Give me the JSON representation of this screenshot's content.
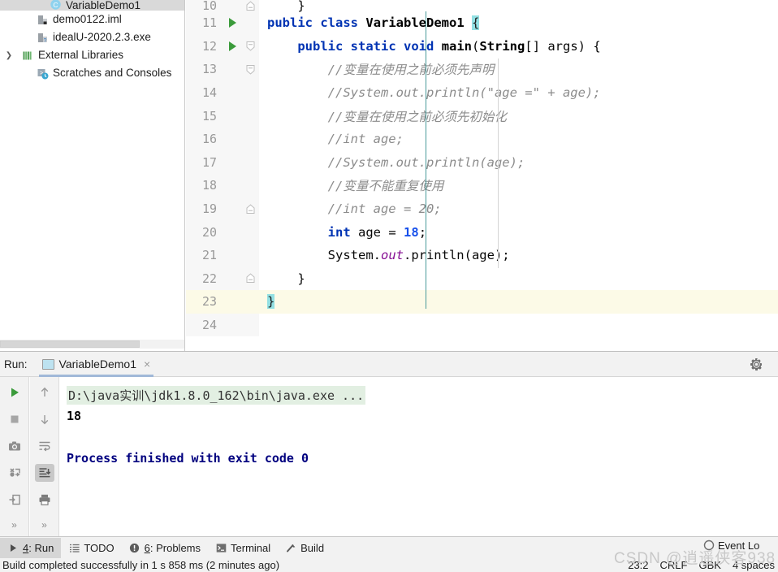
{
  "project_tree": {
    "items": [
      {
        "label": "VariableDemo1",
        "icon": "java-class-icon",
        "indent": 56,
        "selected": true,
        "clipped": true,
        "arrow": false
      },
      {
        "label": "demo0122.iml",
        "icon": "iml-file-icon",
        "indent": 40,
        "selected": false,
        "clipped": false,
        "arrow": false
      },
      {
        "label": "idealU-2020.2.3.exe",
        "icon": "exe-file-icon",
        "indent": 40,
        "selected": false,
        "clipped": false,
        "arrow": false
      },
      {
        "label": "External Libraries",
        "icon": "libraries-icon",
        "indent": 22,
        "selected": false,
        "clipped": false,
        "arrow": true
      },
      {
        "label": "Scratches and Consoles",
        "icon": "scratches-icon",
        "indent": 40,
        "selected": false,
        "clipped": false,
        "arrow": false
      }
    ]
  },
  "editor": {
    "lines": [
      {
        "number": "10",
        "clipped": true,
        "run_marker": false,
        "fold": "end",
        "current": false,
        "tokens": [
          {
            "t": "    }",
            "c": "pl"
          }
        ]
      },
      {
        "number": "11",
        "clipped": false,
        "run_marker": true,
        "fold": "none",
        "current": false,
        "tokens": [
          {
            "t": "public",
            "c": "k"
          },
          {
            "t": " ",
            "c": "pl"
          },
          {
            "t": "class",
            "c": "k"
          },
          {
            "t": " ",
            "c": "pl"
          },
          {
            "t": "VariableDemo1",
            "c": "cn"
          },
          {
            "t": " ",
            "c": "pl"
          },
          {
            "t": "{",
            "c": "brmatch"
          }
        ]
      },
      {
        "number": "12",
        "clipped": false,
        "run_marker": true,
        "fold": "start",
        "current": false,
        "tokens": [
          {
            "t": "    ",
            "c": "pl"
          },
          {
            "t": "public",
            "c": "k"
          },
          {
            "t": " ",
            "c": "pl"
          },
          {
            "t": "static",
            "c": "k"
          },
          {
            "t": " ",
            "c": "pl"
          },
          {
            "t": "void",
            "c": "k"
          },
          {
            "t": " ",
            "c": "pl"
          },
          {
            "t": "main",
            "c": "cn"
          },
          {
            "t": "(",
            "c": "pl"
          },
          {
            "t": "String",
            "c": "cn"
          },
          {
            "t": "[] args) {",
            "c": "pl"
          }
        ]
      },
      {
        "number": "13",
        "clipped": false,
        "run_marker": false,
        "fold": "start",
        "current": false,
        "tokens": [
          {
            "t": "        //变量在使用之前必须先声明",
            "c": "cm"
          }
        ]
      },
      {
        "number": "14",
        "clipped": false,
        "run_marker": false,
        "fold": "none",
        "current": false,
        "tokens": [
          {
            "t": "        //System.out.println(\"age =\" + age);",
            "c": "cm"
          }
        ]
      },
      {
        "number": "15",
        "clipped": false,
        "run_marker": false,
        "fold": "none",
        "current": false,
        "tokens": [
          {
            "t": "        //变量在使用之前必须先初始化",
            "c": "cm"
          }
        ]
      },
      {
        "number": "16",
        "clipped": false,
        "run_marker": false,
        "fold": "none",
        "current": false,
        "tokens": [
          {
            "t": "        //int age;",
            "c": "cm"
          }
        ]
      },
      {
        "number": "17",
        "clipped": false,
        "run_marker": false,
        "fold": "none",
        "current": false,
        "tokens": [
          {
            "t": "        //System.out.println(age);",
            "c": "cm"
          }
        ]
      },
      {
        "number": "18",
        "clipped": false,
        "run_marker": false,
        "fold": "none",
        "current": false,
        "tokens": [
          {
            "t": "        //变量不能重复使用",
            "c": "cm"
          }
        ]
      },
      {
        "number": "19",
        "clipped": false,
        "run_marker": false,
        "fold": "end",
        "current": false,
        "tokens": [
          {
            "t": "        //int age = 20;",
            "c": "cm"
          }
        ]
      },
      {
        "number": "20",
        "clipped": false,
        "run_marker": false,
        "fold": "none",
        "current": false,
        "tokens": [
          {
            "t": "        ",
            "c": "pl"
          },
          {
            "t": "int",
            "c": "k"
          },
          {
            "t": " age ",
            "c": "pl"
          },
          {
            "t": "=",
            "c": "pl"
          },
          {
            "t": " ",
            "c": "pl"
          },
          {
            "t": "18",
            "c": "num"
          },
          {
            "t": ";",
            "c": "pl"
          }
        ]
      },
      {
        "number": "21",
        "clipped": false,
        "run_marker": false,
        "fold": "none",
        "current": false,
        "tokens": [
          {
            "t": "        System.",
            "c": "pl"
          },
          {
            "t": "out",
            "c": "sf"
          },
          {
            "t": ".println(age);",
            "c": "pl"
          }
        ]
      },
      {
        "number": "22",
        "clipped": false,
        "run_marker": false,
        "fold": "end",
        "current": false,
        "tokens": [
          {
            "t": "    }",
            "c": "pl"
          }
        ]
      },
      {
        "number": "23",
        "clipped": false,
        "run_marker": false,
        "fold": "none",
        "current": true,
        "tokens": [
          {
            "t": "}",
            "c": "brmatch"
          }
        ]
      },
      {
        "number": "24",
        "clipped": false,
        "run_marker": false,
        "fold": "none",
        "current": false,
        "tokens": [
          {
            "t": "",
            "c": "pl"
          }
        ]
      }
    ]
  },
  "run_window": {
    "label": "Run:",
    "tab_title": "VariableDemo1",
    "tab_close": "×",
    "gear_icon": "gear-icon",
    "toolbar_left": [
      {
        "icon": "rerun-icon"
      },
      {
        "icon": "stop-icon"
      },
      {
        "icon": "camera-icon"
      },
      {
        "icon": "thread-dump-icon"
      },
      {
        "icon": "export-icon"
      }
    ],
    "toolbar_left_more": "»",
    "toolbar_right": [
      {
        "icon": "arrow-up-icon"
      },
      {
        "icon": "arrow-down-icon"
      },
      {
        "icon": "soft-wrap-icon"
      },
      {
        "icon": "scroll-to-end-icon",
        "pressed": true
      },
      {
        "icon": "print-icon"
      }
    ],
    "toolbar_right_more": "»",
    "console": [
      {
        "text": "D:\\java实训\\jdk1.8.0_162\\bin\\java.exe ...",
        "style": "cmd"
      },
      {
        "text": "18",
        "style": "out"
      },
      {
        "text": "",
        "style": "out"
      },
      {
        "text": "Process finished with exit code 0",
        "style": "fin"
      }
    ]
  },
  "bottom_bar": {
    "items": [
      {
        "label": "4: Run",
        "icon": "run-icon",
        "active": true,
        "mnemonic": "4"
      },
      {
        "label": "TODO",
        "icon": "todo-icon",
        "active": false,
        "mnemonic": ""
      },
      {
        "label": "6: Problems",
        "icon": "problems-icon",
        "active": false,
        "mnemonic": "6"
      },
      {
        "label": "Terminal",
        "icon": "terminal-icon",
        "active": false,
        "mnemonic": ""
      },
      {
        "label": "Build",
        "icon": "build-icon",
        "active": false,
        "mnemonic": ""
      }
    ],
    "event_log": {
      "label": "Event Lo",
      "icon": "event-log-icon"
    }
  },
  "status_bar": {
    "message": "Build completed successfully in 1 s 858 ms (2 minutes ago)",
    "caret_position": "23:2",
    "line_separator": "CRLF",
    "encoding": "GBK",
    "indent": "4 spaces"
  },
  "watermark": {
    "text": "CSDN @逍遥侠客938"
  },
  "colors": {
    "keyword": "#0033b3",
    "number": "#1750eb",
    "static_field": "#871094",
    "comment": "#8c8c8c",
    "brace_match": "#93e0e3",
    "current_line": "#fcfae7",
    "console_cmd_bg": "#e2efe2",
    "console_finished": "#00007f",
    "run_green": "#3b9b3b"
  }
}
